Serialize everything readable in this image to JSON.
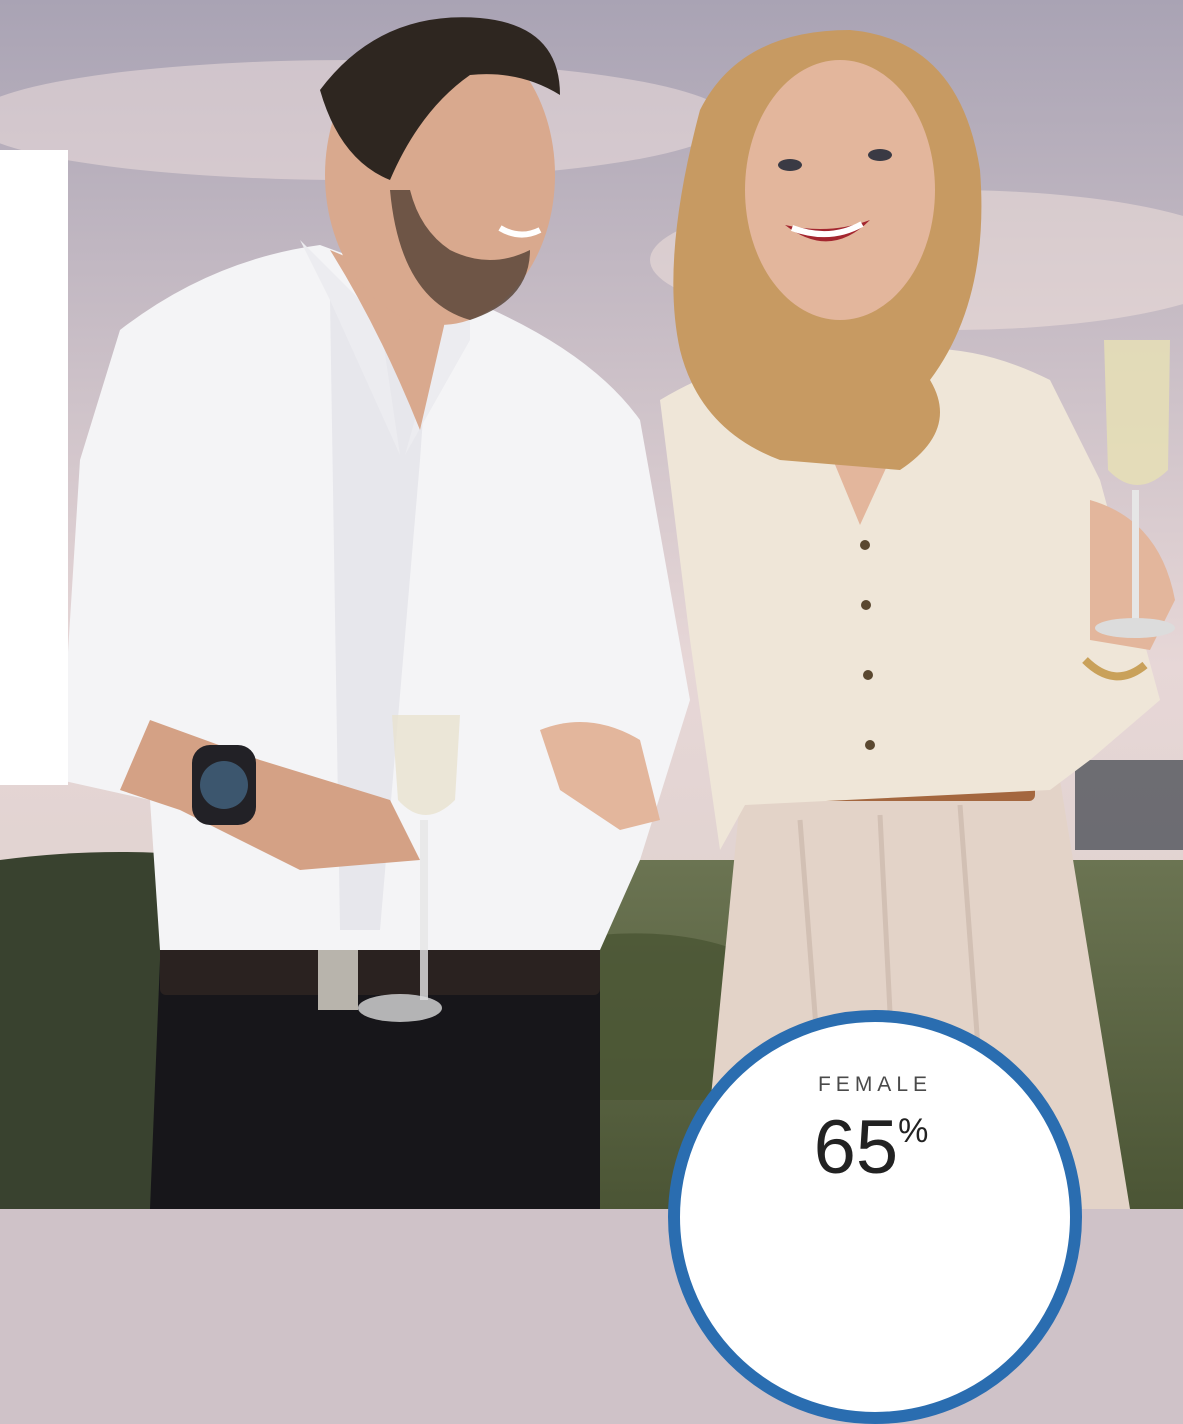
{
  "photo": {
    "subjects": [
      "man-in-white-shirt",
      "woman-in-cream-blouse"
    ],
    "colors": {
      "sky_top": "#a9a3b4",
      "sky_bottom": "#e7d7d7",
      "ground": "#5f6b47",
      "hedge": "#39422f",
      "man_shirt": "#f4f4f6",
      "man_pants": "#17161a",
      "woman_blouse": "#efe6d8",
      "woman_skirt": "#e3d3c8",
      "skin": "#d9a98e",
      "hair_man": "#2e2620",
      "hair_woman": "#c79a62"
    }
  },
  "stat": {
    "label": "FEMALE",
    "value": "65",
    "unit": "%",
    "ring_color": "#2a6db0"
  }
}
